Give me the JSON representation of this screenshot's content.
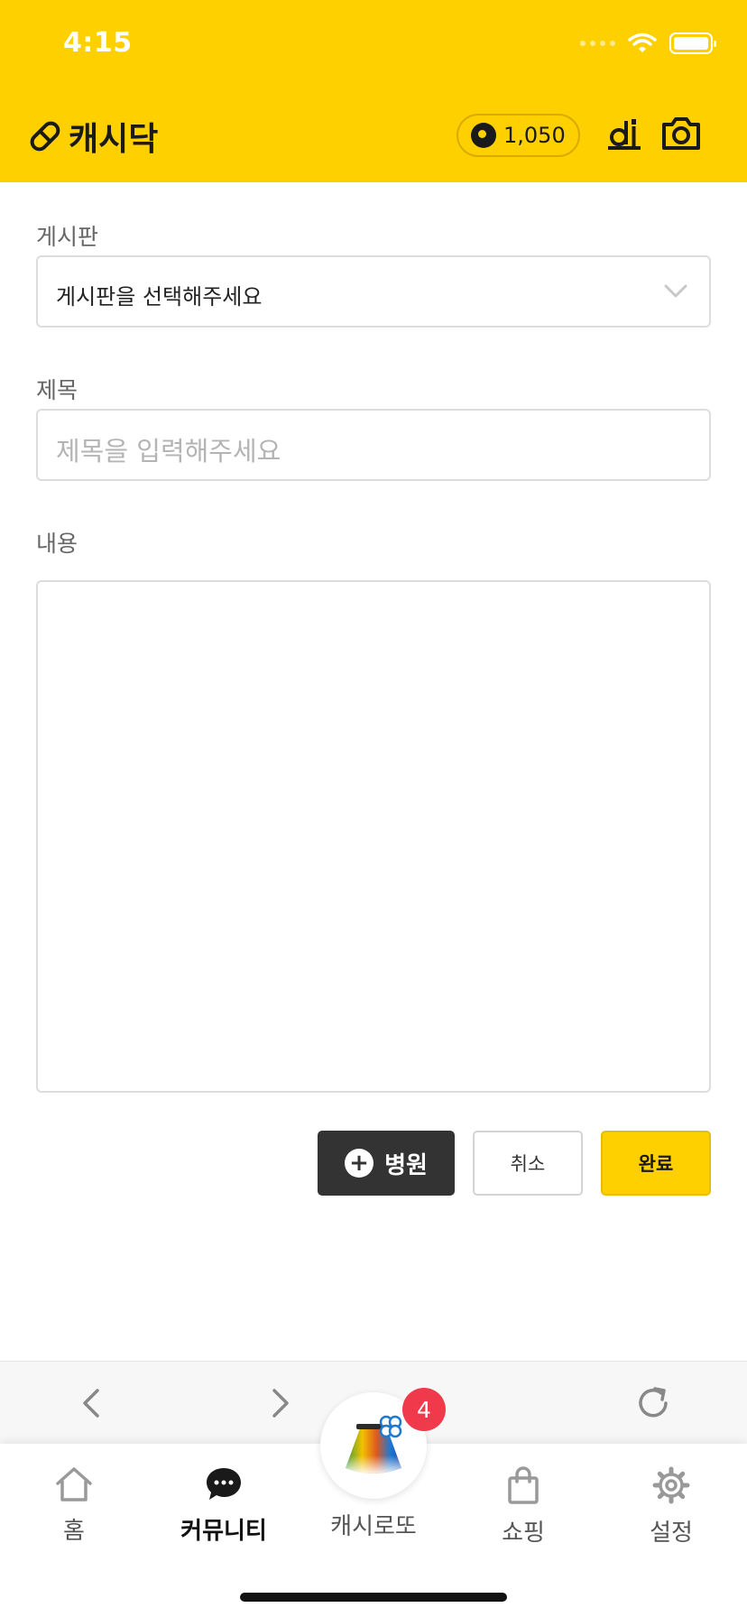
{
  "status_bar": {
    "time": "4:15"
  },
  "header": {
    "logo_text": "캐시닥",
    "cash_amount": "1,050",
    "icons": [
      "pill-logo-icon",
      "cash-coin-icon",
      "bell-d-icon",
      "camera-icon"
    ]
  },
  "form": {
    "board_label": "게시판",
    "board_select_value": "게시판을 선택해주세요",
    "title_label": "제목",
    "title_placeholder": "제목을 입력해주세요",
    "content_label": "내용",
    "content_value": ""
  },
  "buttons": {
    "hospital": "병원",
    "cancel": "취소",
    "done": "완료"
  },
  "tabbar": {
    "items": [
      {
        "label": "홈",
        "icon": "home-icon"
      },
      {
        "label": "커뮤니티",
        "icon": "chat-bubble-icon",
        "active": true
      },
      {
        "label": "캐시로또",
        "icon": "lotto-bag-icon"
      },
      {
        "label": "쇼핑",
        "icon": "shopping-bag-icon"
      },
      {
        "label": "설정",
        "icon": "gear-icon"
      }
    ],
    "lotto_badge": "4"
  },
  "colors": {
    "brand_yellow": "#FFD000",
    "dark_button": "#333333",
    "badge_red": "#F03A4C"
  }
}
